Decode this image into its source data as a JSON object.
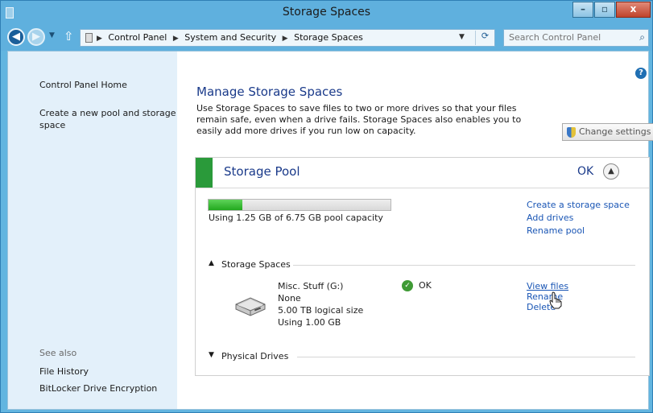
{
  "window": {
    "title": "Storage Spaces",
    "controls": {
      "minimize": "–",
      "maximize": "▫",
      "close": "x"
    }
  },
  "address": {
    "breadcrumbs": [
      "Control Panel",
      "System and Security",
      "Storage Spaces"
    ],
    "search_placeholder": "Search Control Panel"
  },
  "sidebar": {
    "home": "Control Panel Home",
    "create_pool": "Create a new pool and storage space",
    "see_also": "See also",
    "file_history": "File History",
    "bitlocker": "BitLocker Drive Encryption"
  },
  "main": {
    "heading": "Manage Storage Spaces",
    "description": "Use Storage Spaces to save files to two or more drives so that your files remain safe, even when a drive fails. Storage Spaces also enables you to easily add more drives if you run low on capacity.",
    "change_settings": "Change settings"
  },
  "pool": {
    "title": "Storage Pool",
    "status": "OK",
    "usage_fraction": 0.185,
    "usage_text": "Using 1.25 GB of 6.75 GB pool capacity",
    "actions": [
      "Create a storage space",
      "Add drives",
      "Rename pool"
    ],
    "storage_spaces_label": "Storage Spaces",
    "physical_drives_label": "Physical Drives"
  },
  "space": {
    "name": "Misc. Stuff (G:)",
    "resiliency": "None",
    "logical_size": "5.00 TB logical size",
    "used": "Using 1.00 GB",
    "status": "OK",
    "actions": {
      "view": "View files",
      "rename": "Rename",
      "delete": "Delete"
    }
  },
  "colors": {
    "accent_green": "#2a9a3a",
    "link_blue": "#1a56b5",
    "heading_blue": "#1a3a8a",
    "frame_blue": "#5fb0de"
  }
}
